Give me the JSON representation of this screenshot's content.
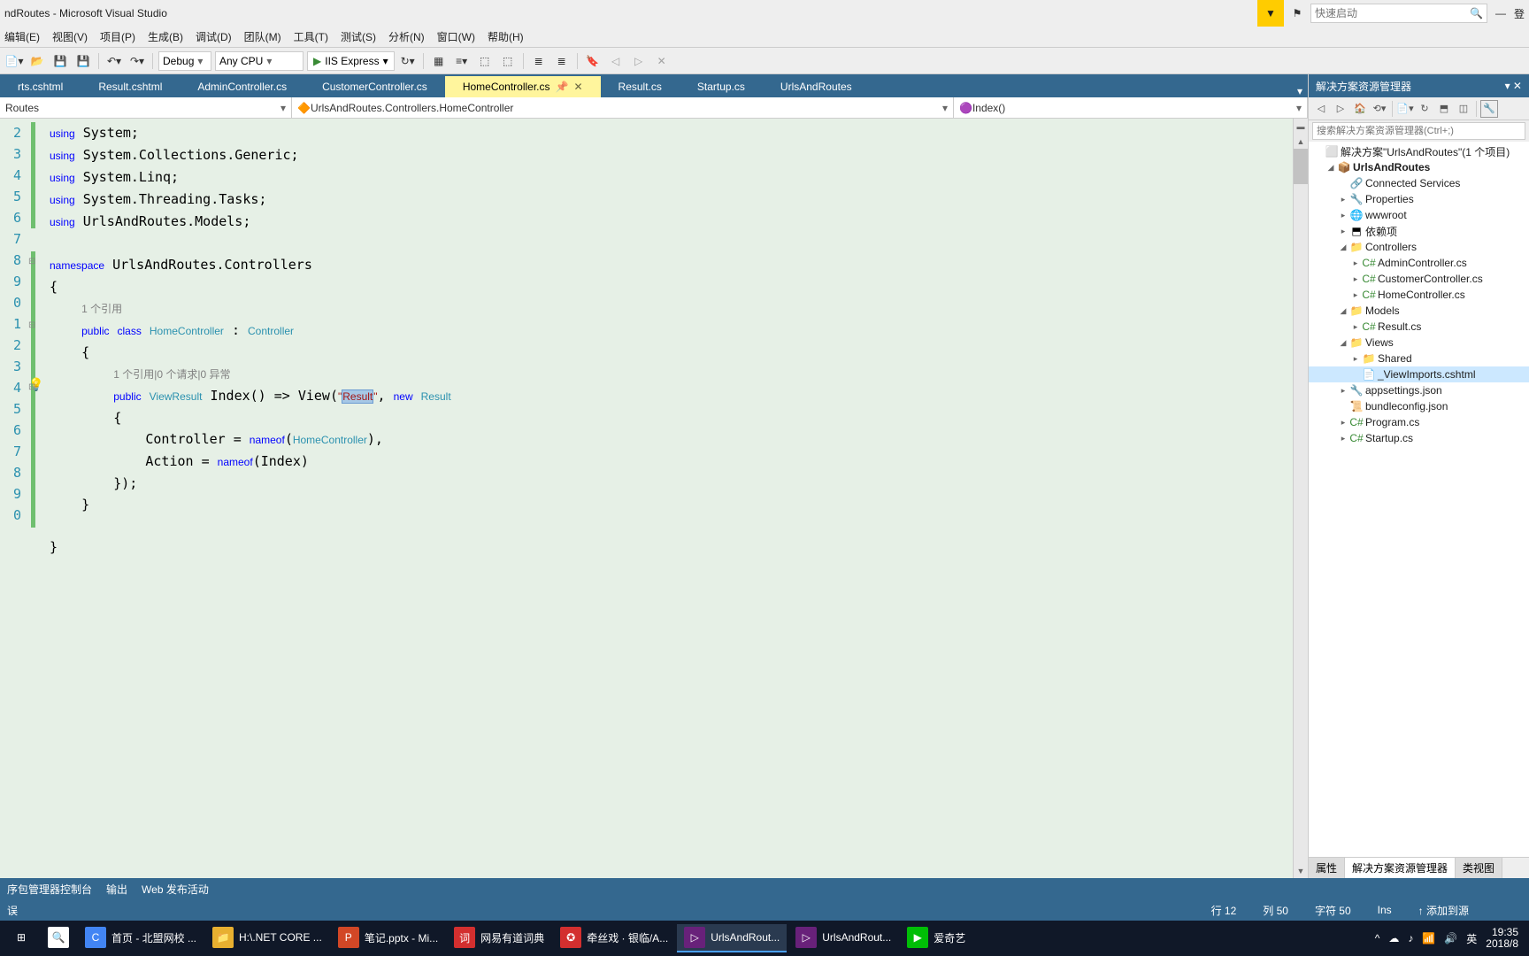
{
  "title": "ndRoutes - Microsoft Visual Studio",
  "quick_launch": {
    "placeholder": "快速启动"
  },
  "menu": [
    "编辑(E)",
    "视图(V)",
    "项目(P)",
    "生成(B)",
    "调试(D)",
    "团队(M)",
    "工具(T)",
    "测试(S)",
    "分析(N)",
    "窗口(W)",
    "帮助(H)"
  ],
  "toolbar": {
    "config": "Debug",
    "platform": "Any CPU",
    "run": "IIS Express"
  },
  "doc_tabs": [
    "rts.cshtml",
    "Result.cshtml",
    "AdminController.cs",
    "CustomerController.cs",
    "HomeController.cs",
    "Result.cs",
    "Startup.cs",
    "UrlsAndRoutes"
  ],
  "doc_active_index": 4,
  "nav": {
    "left": "Routes",
    "mid": "UrlsAndRoutes.Controllers.HomeController",
    "right": "Index()"
  },
  "line_numbers": [
    "2",
    "3",
    "4",
    "5",
    "6",
    "7",
    "8",
    "9",
    "",
    "0",
    "1",
    "",
    "2",
    "3",
    "4",
    "5",
    "6",
    "7",
    "8",
    "9",
    "",
    "0"
  ],
  "codelens": {
    "a": "1 个引用",
    "b": "1 个引用|0 个请求|0 异常"
  },
  "code_tokens": {
    "using": "using",
    "ns": "namespace",
    "pub": "public",
    "cls": "class",
    "new": "new",
    "System": "System;",
    "Generic": "System.Collections.Generic;",
    "Linq": "System.Linq;",
    "Tasks": "System.Threading.Tasks;",
    "Models": "UrlsAndRoutes.Models;",
    "ns_name": "UrlsAndRoutes.Controllers",
    "HomeController": "HomeController",
    "Controller": "Controller",
    "ViewResult": "ViewResult",
    "Index": "Index()",
    "arrow": " => View(",
    "q1": "\"",
    "Result": "Result",
    "q2": "\"",
    "comma": ", ",
    "ResultType": "Result",
    "body1": "Controller = ",
    "nameof": "nameof",
    "hp": "(",
    "hc": "HomeController",
    "hpc": "),",
    "body2": "Action = ",
    "ip": "(Index)"
  },
  "solution_title": "解决方案资源管理器",
  "solution_search": "搜索解决方案资源管理器(Ctrl+;)",
  "tree": {
    "sln": "解决方案\"UrlsAndRoutes\"(1 个项目)",
    "proj": "UrlsAndRoutes",
    "nodes": [
      {
        "d": 2,
        "exp": "",
        "ico": "🔗",
        "lbl": "Connected Services"
      },
      {
        "d": 2,
        "exp": "▸",
        "ico": "🔧",
        "lbl": "Properties"
      },
      {
        "d": 2,
        "exp": "▸",
        "ico": "🌐",
        "lbl": "wwwroot"
      },
      {
        "d": 2,
        "exp": "▸",
        "ico": "⬒",
        "lbl": "依赖项"
      },
      {
        "d": 2,
        "exp": "◢",
        "ico": "📁",
        "lbl": "Controllers"
      },
      {
        "d": 3,
        "exp": "▸",
        "ico": "C#",
        "lbl": "AdminController.cs"
      },
      {
        "d": 3,
        "exp": "▸",
        "ico": "C#",
        "lbl": "CustomerController.cs"
      },
      {
        "d": 3,
        "exp": "▸",
        "ico": "C#",
        "lbl": "HomeController.cs"
      },
      {
        "d": 2,
        "exp": "◢",
        "ico": "📁",
        "lbl": "Models"
      },
      {
        "d": 3,
        "exp": "▸",
        "ico": "C#",
        "lbl": "Result.cs"
      },
      {
        "d": 2,
        "exp": "◢",
        "ico": "📁",
        "lbl": "Views"
      },
      {
        "d": 3,
        "exp": "▸",
        "ico": "📁",
        "lbl": "Shared"
      },
      {
        "d": 3,
        "exp": "",
        "ico": "📄",
        "lbl": "_ViewImports.cshtml",
        "sel": true
      },
      {
        "d": 2,
        "exp": "▸",
        "ico": "🔧",
        "lbl": "appsettings.json"
      },
      {
        "d": 2,
        "exp": "",
        "ico": "📜",
        "lbl": "bundleconfig.json"
      },
      {
        "d": 2,
        "exp": "▸",
        "ico": "C#",
        "lbl": "Program.cs"
      },
      {
        "d": 2,
        "exp": "▸",
        "ico": "C#",
        "lbl": "Startup.cs"
      }
    ]
  },
  "side_tabs": [
    "属性",
    "解决方案资源管理器",
    "类视图"
  ],
  "bottom_tabs": [
    "序包管理器控制台",
    "输出",
    "Web 发布活动"
  ],
  "status": {
    "err": "误",
    "ln": "行 12",
    "col": "列 50",
    "ch": "字符 50",
    "ins": "Ins",
    "add": "添加到源"
  },
  "taskbar": [
    {
      "ico": "⊞",
      "bg": "",
      "lbl": ""
    },
    {
      "oco": "🔍",
      "bg": "#fff",
      "lbl": ""
    },
    {
      "ico": "C",
      "bg": "#4285f4",
      "lbl": "首页 - 北盟网校 ..."
    },
    {
      "ico": "📁",
      "bg": "#e8b030",
      "lbl": "H:\\.NET CORE ..."
    },
    {
      "ico": "P",
      "bg": "#d24726",
      "lbl": "笔记.pptx - Mi..."
    },
    {
      "ico": "词",
      "bg": "#d32f2f",
      "lbl": "网易有道词典"
    },
    {
      "ico": "✪",
      "bg": "#d32f2f",
      "lbl": "牵丝戏 · 银临/A..."
    },
    {
      "ico": "▷",
      "bg": "#68217a",
      "lbl": "UrlsAndRout...",
      "active": true
    },
    {
      "ico": "▷",
      "bg": "#68217a",
      "lbl": "UrlsAndRout..."
    },
    {
      "ico": "▶",
      "bg": "#00be06",
      "lbl": "爱奇艺"
    }
  ],
  "tray": {
    "time": "19:35",
    "date": "2018/8"
  }
}
